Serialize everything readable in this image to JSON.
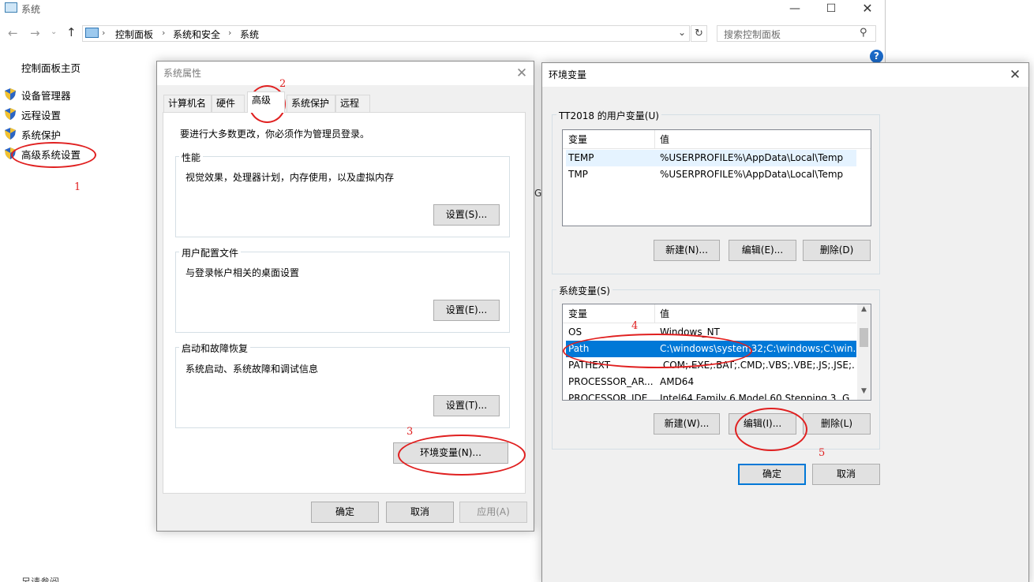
{
  "explorer": {
    "title": "系统",
    "breadcrumb": [
      "控制面板",
      "系统和安全",
      "系统"
    ],
    "search_placeholder": "搜索控制面板",
    "nav": {
      "home": "控制面板主页",
      "items": [
        {
          "label": "设备管理器"
        },
        {
          "label": "远程设置"
        },
        {
          "label": "系统保护"
        },
        {
          "label": "高级系统设置"
        }
      ],
      "bottom_partial": "另请参阅"
    },
    "peek_text": "GI"
  },
  "sysprops": {
    "title": "系统属性",
    "tabs": [
      "计算机名",
      "硬件",
      "高级",
      "系统保护",
      "远程"
    ],
    "active_tab": "高级",
    "admin_note": "要进行大多数更改，你必须作为管理员登录。",
    "groups": [
      {
        "label": "性能",
        "desc": "视觉效果，处理器计划，内存使用，以及虚拟内存",
        "button": "设置(S)..."
      },
      {
        "label": "用户配置文件",
        "desc": "与登录帐户相关的桌面设置",
        "button": "设置(E)..."
      },
      {
        "label": "启动和故障恢复",
        "desc": "系统启动、系统故障和调试信息",
        "button": "设置(T)..."
      }
    ],
    "env_button": "环境变量(N)...",
    "ok": "确定",
    "cancel": "取消",
    "apply": "应用(A)"
  },
  "envvars": {
    "title": "环境变量",
    "user_group_label": "TT2018 的用户变量(U)",
    "col_var": "变量",
    "col_val": "值",
    "user_rows": [
      {
        "name": "TEMP",
        "value": "%USERPROFILE%\\AppData\\Local\\Temp"
      },
      {
        "name": "TMP",
        "value": "%USERPROFILE%\\AppData\\Local\\Temp"
      }
    ],
    "user_buttons": {
      "new": "新建(N)...",
      "edit": "编辑(E)...",
      "delete": "删除(D)"
    },
    "sys_group_label": "系统变量(S)",
    "sys_rows": [
      {
        "name": "OS",
        "value": "Windows_NT"
      },
      {
        "name": "Path",
        "value": "C:\\windows\\system32;C:\\windows;C:\\win..."
      },
      {
        "name": "PATHEXT",
        "value": ".COM;.EXE;.BAT;.CMD;.VBS;.VBE;.JS;.JSE;..."
      },
      {
        "name": "PROCESSOR_AR...",
        "value": "AMD64"
      },
      {
        "name": "PROCESSOR_IDE...",
        "value": "Intel64 Family 6 Model 60 Stepping 3, G..."
      }
    ],
    "selected_row": "Path",
    "sys_buttons": {
      "new": "新建(W)...",
      "edit": "编辑(I)...",
      "delete": "删除(L)"
    },
    "ok": "确定",
    "cancel": "取消"
  },
  "annotations": [
    "1",
    "2",
    "3",
    "4",
    "5"
  ],
  "colors": {
    "accent": "#0078d7",
    "annotation": "#e02020",
    "dialog_bg": "#f0f0f0"
  }
}
